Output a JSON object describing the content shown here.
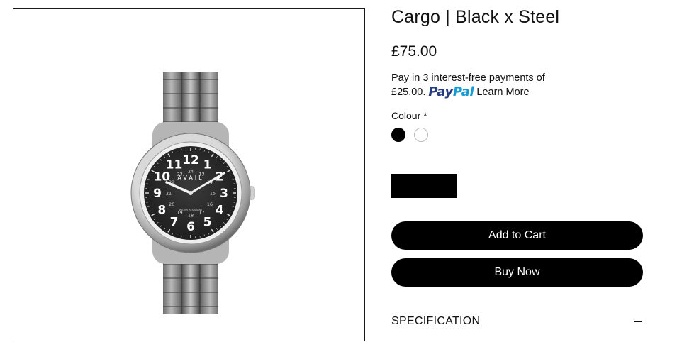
{
  "product": {
    "image": {
      "brand_text": "AVAIL",
      "dial_text": "WATER RESISTANT",
      "hours": [
        "12",
        "1",
        "2",
        "3",
        "4",
        "5",
        "6",
        "7",
        "8",
        "9",
        "10",
        "11"
      ],
      "inner_hours": [
        "24",
        "13",
        "14",
        "15",
        "16",
        "17",
        "18",
        "19",
        "20",
        "21",
        "22",
        "23"
      ]
    },
    "title": "Cargo | Black x Steel",
    "price": "£75.00",
    "paypal": {
      "message": "Pay in 3 interest-free payments of £25.00.",
      "logo_part1": "Pay",
      "logo_part2": "Pal",
      "learn_more": "Learn More"
    },
    "colour_label": "Colour *",
    "colours": [
      {
        "name": "black",
        "hex": "#000000"
      },
      {
        "name": "white",
        "hex": "#ffffff"
      }
    ],
    "add_to_cart": "Add to Cart",
    "buy_now": "Buy Now",
    "specification": "SPECIFICATION",
    "specification_icon": "minus-icon"
  }
}
